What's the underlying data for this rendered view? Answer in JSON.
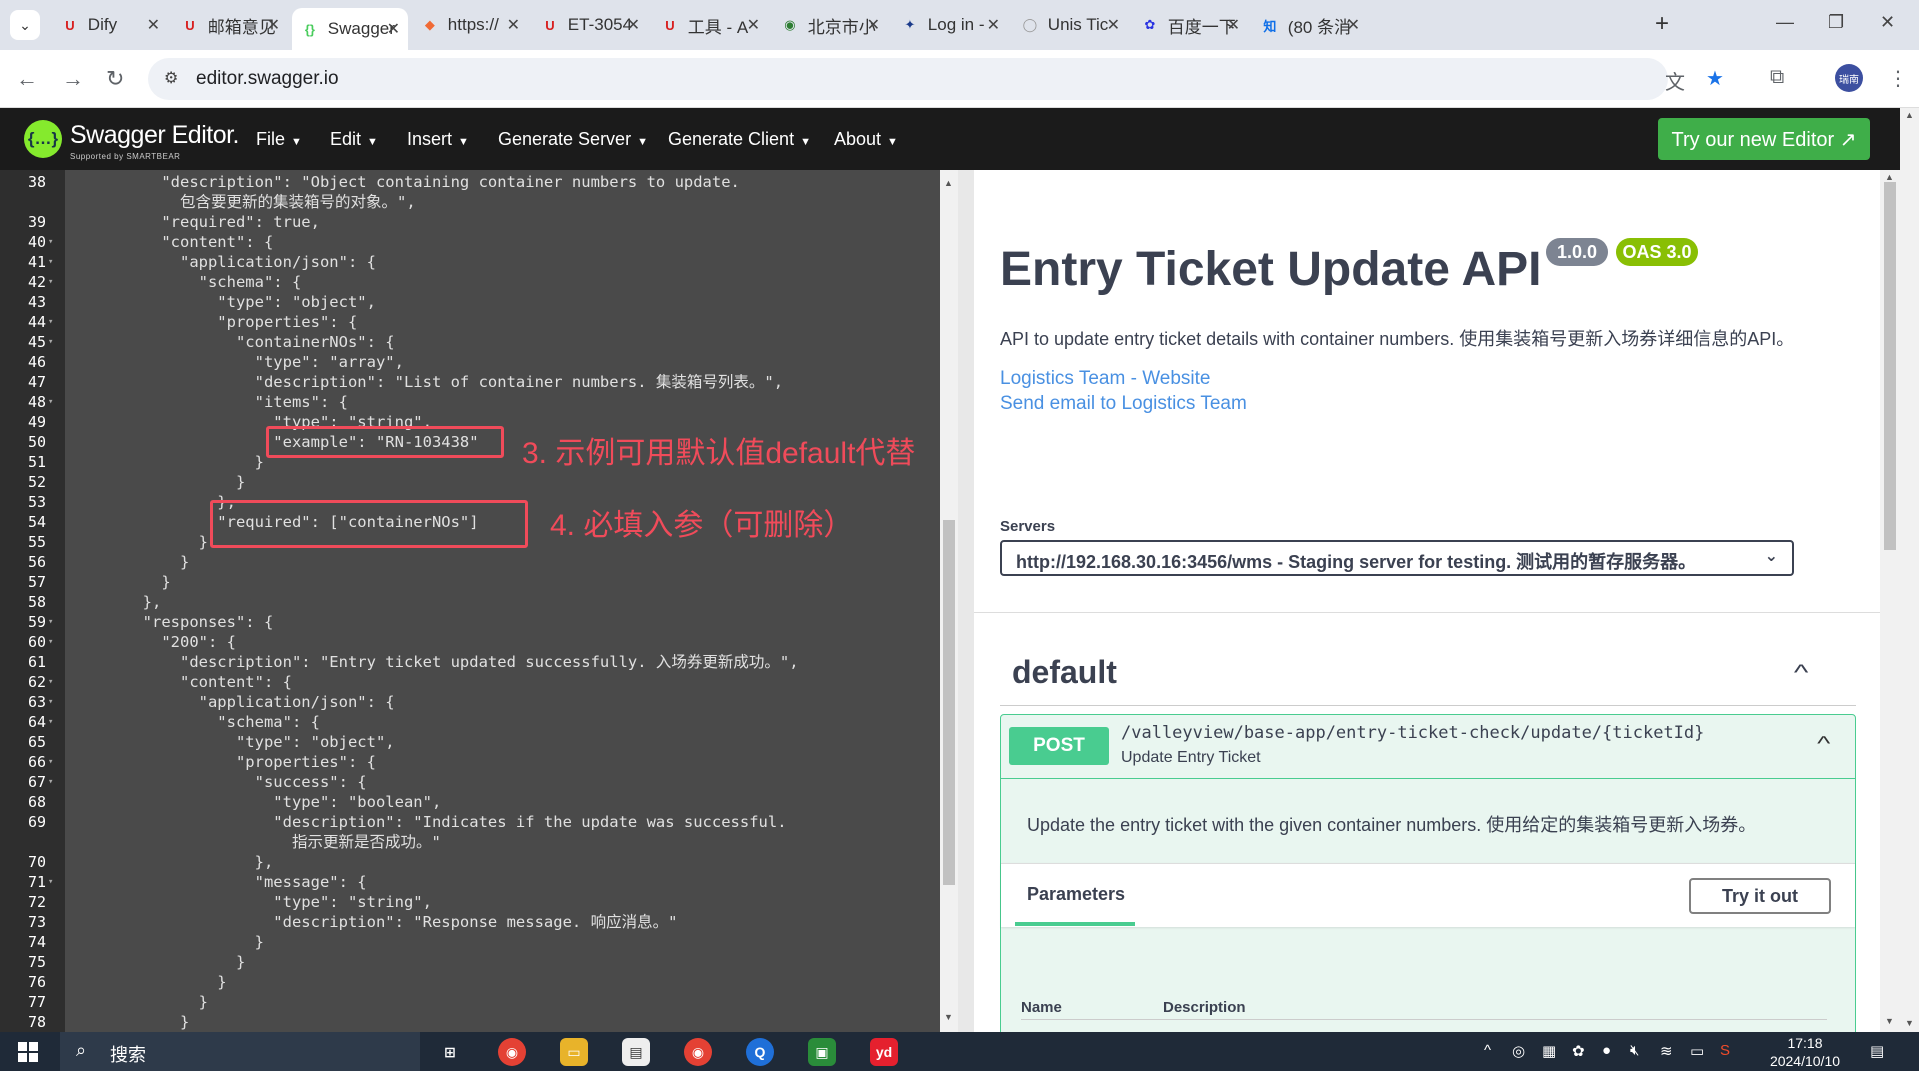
{
  "browser": {
    "tabs": [
      {
        "label": "Dify",
        "icon": "U",
        "icon_color": "#d81e1e",
        "active": false
      },
      {
        "label": "邮箱意见",
        "icon": "U",
        "icon_color": "#d81e1e",
        "active": false
      },
      {
        "label": "Swagger",
        "icon": "{}",
        "icon_color": "#49cc5c",
        "active": true
      },
      {
        "label": "https://",
        "icon": "◆",
        "icon_color": "#f06a35",
        "active": false
      },
      {
        "label": "ET-3054",
        "icon": "U",
        "icon_color": "#d81e1e",
        "active": false
      },
      {
        "label": "工具 - A",
        "icon": "U",
        "icon_color": "#d81e1e",
        "active": false
      },
      {
        "label": "北京市小",
        "icon": "◉",
        "icon_color": "#2d7d32",
        "active": false
      },
      {
        "label": "Log in -",
        "icon": "✦",
        "icon_color": "#1a3a8a",
        "active": false
      },
      {
        "label": "Unis Tic",
        "icon": "◯",
        "icon_color": "#999999",
        "active": false
      },
      {
        "label": "百度一下",
        "icon": "✿",
        "icon_color": "#2932e1",
        "active": false
      },
      {
        "label": "(80 条消",
        "icon": "知",
        "icon_color": "#0f6fe8",
        "active": false
      }
    ],
    "url": "editor.swagger.io",
    "avatar_text": "瑞南"
  },
  "swagger": {
    "logo_text": "Swagger Editor.",
    "logo_sub": "Supported by SMARTBEAR",
    "menu": [
      "File",
      "Edit",
      "Insert",
      "Generate Server",
      "Generate Client",
      "About"
    ],
    "try_new_editor": "Try our new Editor ↗"
  },
  "editor": {
    "lines": [
      {
        "n": "38",
        "fold": false,
        "text": "          \"description\": \"Object containing container numbers to update."
      },
      {
        "n": "",
        "fold": false,
        "text": "            包含要更新的集装箱号的对象。\","
      },
      {
        "n": "39",
        "fold": false,
        "text": "          \"required\": true,"
      },
      {
        "n": "40",
        "fold": true,
        "text": "          \"content\": {"
      },
      {
        "n": "41",
        "fold": true,
        "text": "            \"application/json\": {"
      },
      {
        "n": "42",
        "fold": true,
        "text": "              \"schema\": {"
      },
      {
        "n": "43",
        "fold": false,
        "text": "                \"type\": \"object\","
      },
      {
        "n": "44",
        "fold": true,
        "text": "                \"properties\": {"
      },
      {
        "n": "45",
        "fold": true,
        "text": "                  \"containerNOs\": {"
      },
      {
        "n": "46",
        "fold": false,
        "text": "                    \"type\": \"array\","
      },
      {
        "n": "47",
        "fold": false,
        "text": "                    \"description\": \"List of container numbers. 集装箱号列表。\","
      },
      {
        "n": "48",
        "fold": true,
        "text": "                    \"items\": {"
      },
      {
        "n": "49",
        "fold": false,
        "text": "                      \"type\": \"string\","
      },
      {
        "n": "50",
        "fold": false,
        "text": "                      \"example\": \"RN-103438\""
      },
      {
        "n": "51",
        "fold": false,
        "text": "                    }"
      },
      {
        "n": "52",
        "fold": false,
        "text": "                  }"
      },
      {
        "n": "53",
        "fold": false,
        "text": "                },"
      },
      {
        "n": "54",
        "fold": false,
        "text": "                \"required\": [\"containerNOs\"]"
      },
      {
        "n": "55",
        "fold": false,
        "text": "              }"
      },
      {
        "n": "56",
        "fold": false,
        "text": "            }"
      },
      {
        "n": "57",
        "fold": false,
        "text": "          }"
      },
      {
        "n": "58",
        "fold": false,
        "text": "        },"
      },
      {
        "n": "59",
        "fold": true,
        "text": "        \"responses\": {"
      },
      {
        "n": "60",
        "fold": true,
        "text": "          \"200\": {"
      },
      {
        "n": "61",
        "fold": false,
        "text": "            \"description\": \"Entry ticket updated successfully. 入场券更新成功。\","
      },
      {
        "n": "62",
        "fold": true,
        "text": "            \"content\": {"
      },
      {
        "n": "63",
        "fold": true,
        "text": "              \"application/json\": {"
      },
      {
        "n": "64",
        "fold": true,
        "text": "                \"schema\": {"
      },
      {
        "n": "65",
        "fold": false,
        "text": "                  \"type\": \"object\","
      },
      {
        "n": "66",
        "fold": true,
        "text": "                  \"properties\": {"
      },
      {
        "n": "67",
        "fold": true,
        "text": "                    \"success\": {"
      },
      {
        "n": "68",
        "fold": false,
        "text": "                      \"type\": \"boolean\","
      },
      {
        "n": "69",
        "fold": false,
        "text": "                      \"description\": \"Indicates if the update was successful."
      },
      {
        "n": "",
        "fold": false,
        "text": "                        指示更新是否成功。\""
      },
      {
        "n": "70",
        "fold": false,
        "text": "                    },"
      },
      {
        "n": "71",
        "fold": true,
        "text": "                    \"message\": {"
      },
      {
        "n": "72",
        "fold": false,
        "text": "                      \"type\": \"string\","
      },
      {
        "n": "73",
        "fold": false,
        "text": "                      \"description\": \"Response message. 响应消息。\""
      },
      {
        "n": "74",
        "fold": false,
        "text": "                    }"
      },
      {
        "n": "75",
        "fold": false,
        "text": "                  }"
      },
      {
        "n": "76",
        "fold": false,
        "text": "                }"
      },
      {
        "n": "77",
        "fold": false,
        "text": "              }"
      },
      {
        "n": "78",
        "fold": false,
        "text": "            }"
      }
    ],
    "annotation_3": "3. 示例可用默认值default代替",
    "annotation_4": "4. 必填入参（可删除）"
  },
  "panel": {
    "title": "Entry Ticket Update API",
    "version_badge": "1.0.0",
    "oas_badge": "OAS 3.0",
    "description": "API to update entry ticket details with container numbers. 使用集装箱号更新入场券详细信息的API。",
    "link_website": "Logistics Team - Website",
    "link_email": "Send email to Logistics Team",
    "servers_label": "Servers",
    "server_value": "http://192.168.30.16:3456/wms - Staging server for testing. 测试用的暂存服务器。",
    "tag": "default",
    "operation": {
      "method": "POST",
      "path": "/valleyview/base-app/entry-ticket-check/update/{ticketId}",
      "summary": "Update Entry Ticket",
      "description": "Update the entry ticket with the given container numbers. 使用给定的集装箱号更新入场券。",
      "params_tab": "Parameters",
      "try_it_out": "Try it out",
      "col_name": "Name",
      "col_description": "Description"
    },
    "colors": {
      "post": "#49cc90",
      "title": "#3b4151",
      "link": "#4990e2",
      "badge_version": "#7d8492",
      "badge_oas": "#89bf04"
    }
  },
  "taskbar": {
    "search": "搜索",
    "time": "17:18",
    "date": "2024/10/10"
  }
}
